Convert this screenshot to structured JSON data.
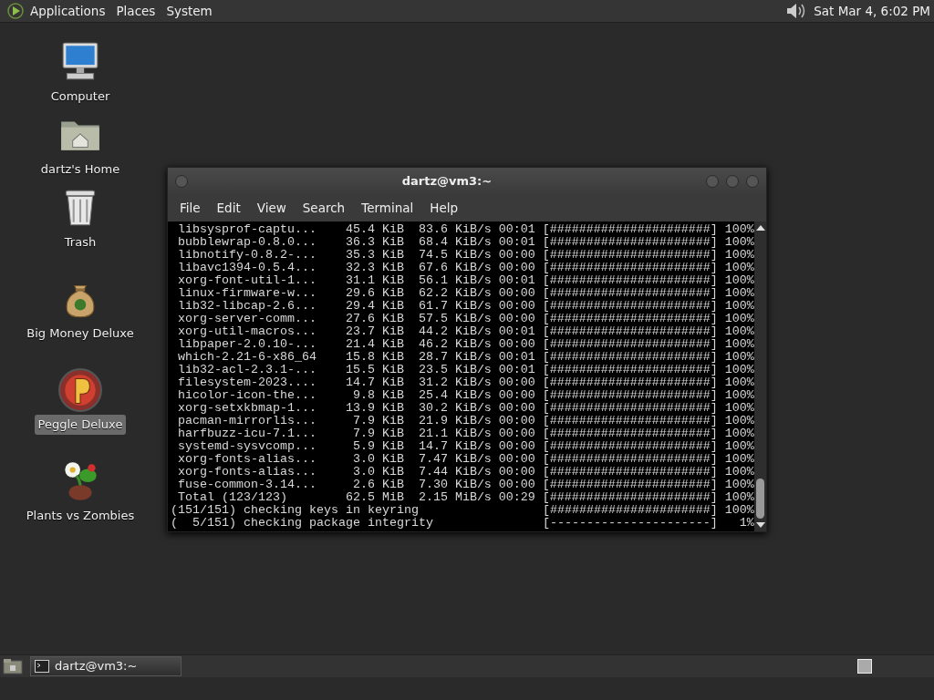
{
  "top_panel": {
    "menus": [
      "Applications",
      "Places",
      "System"
    ],
    "clock": "Sat Mar 4, 6:02 PM"
  },
  "desktop_icons": [
    {
      "kind": "computer",
      "label": "Computer",
      "selected": false
    },
    {
      "kind": "home",
      "label": "dartz's Home",
      "selected": false
    },
    {
      "kind": "trash",
      "label": "Trash",
      "selected": false
    },
    {
      "kind": "moneybag",
      "label": "Big Money Deluxe",
      "selected": false
    },
    {
      "kind": "ball",
      "label": "Peggle Deluxe",
      "selected": true
    },
    {
      "kind": "flower",
      "label": "Plants vs Zombies",
      "selected": false
    }
  ],
  "terminal": {
    "title": "dartz@vm3:~",
    "menu": [
      "File",
      "Edit",
      "View",
      "Search",
      "Terminal",
      "Help"
    ],
    "lines": [
      {
        "kind": "download",
        "name": "libsysprof-captu...",
        "size": "45.4 KiB",
        "rate": "83.6 KiB/s",
        "time": "00:01",
        "bar": "[######################]",
        "percent": "100%"
      },
      {
        "kind": "download",
        "name": "bubblewrap-0.8.0...",
        "size": "36.3 KiB",
        "rate": "68.4 KiB/s",
        "time": "00:01",
        "bar": "[######################]",
        "percent": "100%"
      },
      {
        "kind": "download",
        "name": "libnotify-0.8.2-...",
        "size": "35.3 KiB",
        "rate": "74.5 KiB/s",
        "time": "00:00",
        "bar": "[######################]",
        "percent": "100%"
      },
      {
        "kind": "download",
        "name": "libavc1394-0.5.4...",
        "size": "32.3 KiB",
        "rate": "67.6 KiB/s",
        "time": "00:00",
        "bar": "[######################]",
        "percent": "100%"
      },
      {
        "kind": "download",
        "name": "xorg-font-util-1...",
        "size": "31.1 KiB",
        "rate": "56.1 KiB/s",
        "time": "00:01",
        "bar": "[######################]",
        "percent": "100%"
      },
      {
        "kind": "download",
        "name": "linux-firmware-w...",
        "size": "29.6 KiB",
        "rate": "62.2 KiB/s",
        "time": "00:00",
        "bar": "[######################]",
        "percent": "100%"
      },
      {
        "kind": "download",
        "name": "lib32-libcap-2.6...",
        "size": "29.4 KiB",
        "rate": "61.7 KiB/s",
        "time": "00:00",
        "bar": "[######################]",
        "percent": "100%"
      },
      {
        "kind": "download",
        "name": "xorg-server-comm...",
        "size": "27.6 KiB",
        "rate": "57.5 KiB/s",
        "time": "00:00",
        "bar": "[######################]",
        "percent": "100%"
      },
      {
        "kind": "download",
        "name": "xorg-util-macros...",
        "size": "23.7 KiB",
        "rate": "44.2 KiB/s",
        "time": "00:01",
        "bar": "[######################]",
        "percent": "100%"
      },
      {
        "kind": "download",
        "name": "libpaper-2.0.10-...",
        "size": "21.4 KiB",
        "rate": "46.2 KiB/s",
        "time": "00:00",
        "bar": "[######################]",
        "percent": "100%"
      },
      {
        "kind": "download",
        "name": "which-2.21-6-x86_64",
        "size": "15.8 KiB",
        "rate": "28.7 KiB/s",
        "time": "00:01",
        "bar": "[######################]",
        "percent": "100%"
      },
      {
        "kind": "download",
        "name": "lib32-acl-2.3.1-...",
        "size": "15.5 KiB",
        "rate": "23.5 KiB/s",
        "time": "00:01",
        "bar": "[######################]",
        "percent": "100%"
      },
      {
        "kind": "download",
        "name": "filesystem-2023....",
        "size": "14.7 KiB",
        "rate": "31.2 KiB/s",
        "time": "00:00",
        "bar": "[######################]",
        "percent": "100%"
      },
      {
        "kind": "download",
        "name": "hicolor-icon-the...",
        "size": "9.8 KiB",
        "rate": "25.4 KiB/s",
        "time": "00:00",
        "bar": "[######################]",
        "percent": "100%"
      },
      {
        "kind": "download",
        "name": "xorg-setxkbmap-1...",
        "size": "13.9 KiB",
        "rate": "30.2 KiB/s",
        "time": "00:00",
        "bar": "[######################]",
        "percent": "100%"
      },
      {
        "kind": "download",
        "name": "pacman-mirrorlis...",
        "size": "7.9 KiB",
        "rate": "21.9 KiB/s",
        "time": "00:00",
        "bar": "[######################]",
        "percent": "100%"
      },
      {
        "kind": "download",
        "name": "harfbuzz-icu-7.1...",
        "size": "7.9 KiB",
        "rate": "21.1 KiB/s",
        "time": "00:00",
        "bar": "[######################]",
        "percent": "100%"
      },
      {
        "kind": "download",
        "name": "systemd-sysvcomp...",
        "size": "5.9 KiB",
        "rate": "14.7 KiB/s",
        "time": "00:00",
        "bar": "[######################]",
        "percent": "100%"
      },
      {
        "kind": "download",
        "name": "xorg-fonts-alias...",
        "size": "3.0 KiB",
        "rate": "7.47 KiB/s",
        "time": "00:00",
        "bar": "[######################]",
        "percent": "100%"
      },
      {
        "kind": "download",
        "name": "xorg-fonts-alias...",
        "size": "3.0 KiB",
        "rate": "7.44 KiB/s",
        "time": "00:00",
        "bar": "[######################]",
        "percent": "100%"
      },
      {
        "kind": "download",
        "name": "fuse-common-3.14...",
        "size": "2.6 KiB",
        "rate": "7.30 KiB/s",
        "time": "00:00",
        "bar": "[######################]",
        "percent": "100%"
      },
      {
        "kind": "download",
        "name": "Total (123/123)",
        "size": "62.5 MiB",
        "rate": "2.15 MiB/s",
        "time": "00:29",
        "bar": "[######################]",
        "percent": "100%"
      },
      {
        "kind": "check",
        "message": "(151/151) checking keys in keyring",
        "bar": "[######################]",
        "percent": "100%"
      },
      {
        "kind": "check",
        "message": "(  5/151) checking package integrity",
        "bar": "[----------------------]",
        "percent": "1%"
      }
    ]
  },
  "taskbar": {
    "tasks": [
      {
        "label": "dartz@vm3:~",
        "selected": false
      }
    ]
  }
}
